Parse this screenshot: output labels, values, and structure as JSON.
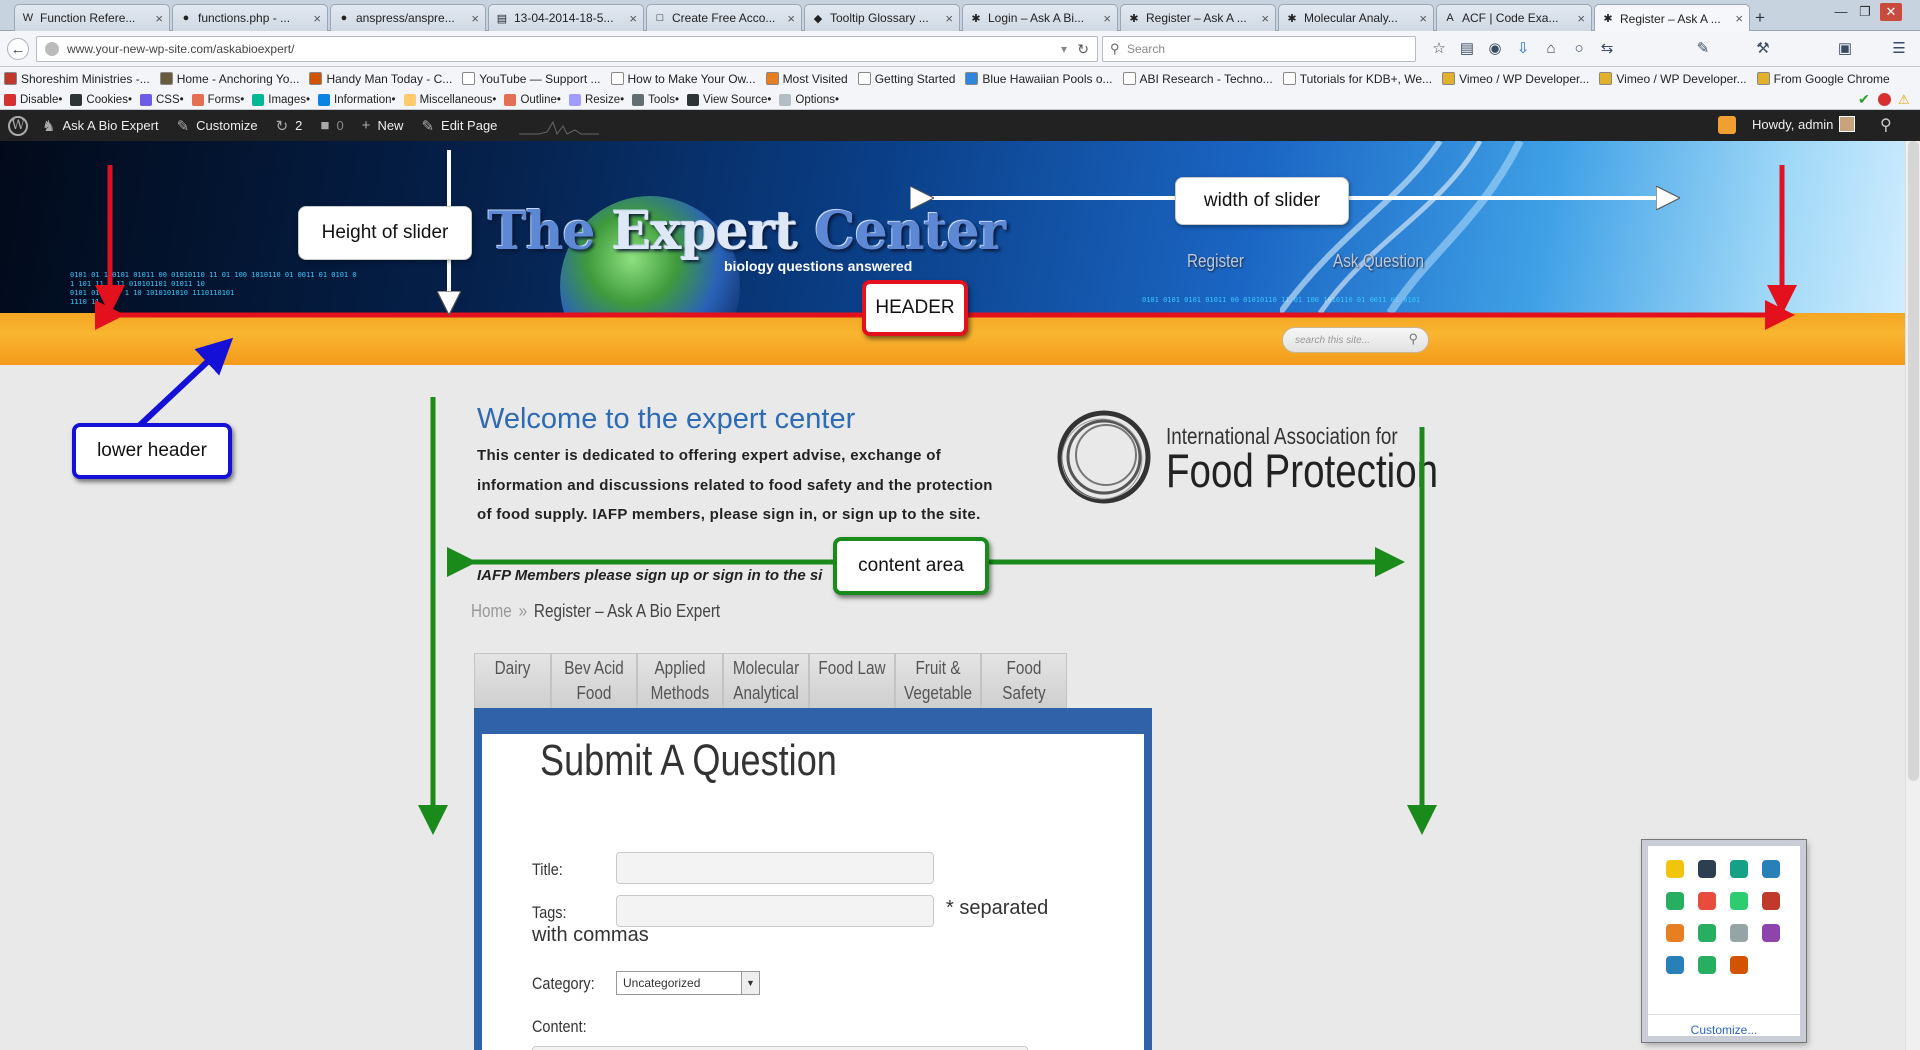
{
  "browser": {
    "tabs": [
      {
        "label": "Function Refere...",
        "icon": "wordpress-icon",
        "active": false
      },
      {
        "label": "functions.php - ...",
        "icon": "github-icon",
        "active": false
      },
      {
        "label": "anspress/anspre...",
        "icon": "github-icon",
        "active": false
      },
      {
        "label": "13-04-2014-18-5...",
        "icon": "image-icon",
        "active": false
      },
      {
        "label": "Create Free Acco...",
        "icon": "page-icon",
        "active": false
      },
      {
        "label": "Tooltip Glossary ...",
        "icon": "cube-icon",
        "active": false
      },
      {
        "label": "Login – Ask A Bi...",
        "icon": "asterisk-icon",
        "active": false
      },
      {
        "label": "Register – Ask A ...",
        "icon": "asterisk-icon",
        "active": false
      },
      {
        "label": "Molecular Analy...",
        "icon": "asterisk-icon",
        "active": false
      },
      {
        "label": "ACF | Code Exa...",
        "icon": "acf-icon",
        "active": false
      },
      {
        "label": "Register – Ask A ...",
        "icon": "asterisk-icon",
        "active": true
      }
    ],
    "new_tab": "+",
    "url": "www.your-new-wp-site.com/askabioexpert/",
    "search_placeholder": "Search",
    "bookmarks": [
      {
        "label": "Shoreshim Ministries -...",
        "color": "#c0392b"
      },
      {
        "label": "Home - Anchoring Yo...",
        "color": "#6b5b3e"
      },
      {
        "label": "Handy Man Today - C...",
        "color": "#d35400"
      },
      {
        "label": "YouTube — Support ...",
        "color": "#ffffff"
      },
      {
        "label": "How to Make Your Ow...",
        "color": "#ffffff"
      },
      {
        "label": "Most Visited",
        "color": "#e67e22"
      },
      {
        "label": "Getting Started",
        "color": "#ffffff"
      },
      {
        "label": "Blue Hawaiian Pools o...",
        "color": "#2e86de"
      },
      {
        "label": "ABI Research - Techno...",
        "color": "#ffffff"
      },
      {
        "label": "Tutorials for KDB+, We...",
        "color": "#ffffff"
      },
      {
        "label": "Vimeo / WP Developer...",
        "color": "#e1b12c"
      },
      {
        "label": "Vimeo / WP Developer...",
        "color": "#e1b12c"
      },
      {
        "label": "From Google Chrome",
        "color": "#e1b12c"
      }
    ],
    "devtools": [
      {
        "label": "Disable•",
        "color": "#d63031"
      },
      {
        "label": "Cookies•",
        "color": "#2d3436"
      },
      {
        "label": "CSS•",
        "color": "#6c5ce7"
      },
      {
        "label": "Forms•",
        "color": "#e17055"
      },
      {
        "label": "Images•",
        "color": "#00b894"
      },
      {
        "label": "Information•",
        "color": "#0984e3"
      },
      {
        "label": "Miscellaneous•",
        "color": "#fdcb6e"
      },
      {
        "label": "Outline•",
        "color": "#e17055"
      },
      {
        "label": "Resize•",
        "color": "#a29bfe"
      },
      {
        "label": "Tools•",
        "color": "#636e72"
      },
      {
        "label": "View Source•",
        "color": "#2d3436"
      },
      {
        "label": "Options•",
        "color": "#b2bec3"
      }
    ]
  },
  "wpbar": {
    "site_name": "Ask A Bio Expert",
    "customize": "Customize",
    "updates_count": "2",
    "comments_count": "0",
    "new_label": "New",
    "edit_label": "Edit Page",
    "howdy": "Howdy, admin"
  },
  "header": {
    "title_part1": "The",
    "title_part2": "Expert",
    "title_part3": "Center",
    "subtitle": "biology questions answered",
    "nav_register": "Register",
    "nav_ask": "Ask Question",
    "binary_text": "0101 01 1 0101 01011 00 01010110 11 01 100 1010110 01 0011 01 0101 0\n1 101 11 1 11 010101101 01011 10\n0101 010 10  1 10 1010101010 1110110101\n1110 11",
    "search_placeholder": "search this site..."
  },
  "annotations": {
    "height_of_slider": "Height of slider",
    "width_of_slider": "width of slider",
    "header": "HEADER",
    "lower_header": "lower header",
    "content_area": "content area"
  },
  "content": {
    "welcome_title": "Welcome to the expert center",
    "intro": "This center is dedicated to offering expert advise, exchange of information and discussions related to food safety and the protection of food supply. IAFP members, please sign in, or sign up to the site.",
    "members_note": "IAFP Members please sign up or sign in to the si",
    "logo_line1": "International Association for",
    "logo_line2": "Food Protection",
    "breadcrumb_home": "Home",
    "breadcrumb_sep": "»",
    "breadcrumb_current": "Register – Ask A Bio Expert",
    "tabs": [
      {
        "line1": "Dairy",
        "line2": ""
      },
      {
        "line1": "Bev Acid",
        "line2": "Food"
      },
      {
        "line1": "Applied",
        "line2": "Methods"
      },
      {
        "line1": "Molecular",
        "line2": "Analytical"
      },
      {
        "line1": "Food Law",
        "line2": ""
      },
      {
        "line1": "Fruit &",
        "line2": "Vegetable"
      },
      {
        "line1": "Food",
        "line2": "Safety"
      }
    ],
    "form": {
      "title": "Submit A Question",
      "title_label": "Title:",
      "tags_label": "Tags:",
      "tags_note": "* separated",
      "tags_note2": "with commas",
      "category_label": "Category:",
      "category_value": "Uncategorized",
      "content_label": "Content:"
    }
  },
  "palette": {
    "customize_link": "Customize...",
    "icon_colors": [
      "#f1c40f",
      "#2c3e50",
      "#16a085",
      "#2980b9",
      "#27ae60",
      "#e74c3c",
      "#2ecc71",
      "#c0392b",
      "#e67e22",
      "#27ae60",
      "#95a5a6",
      "#8e44ad",
      "#2980b9",
      "#27ae60",
      "#d35400"
    ]
  }
}
